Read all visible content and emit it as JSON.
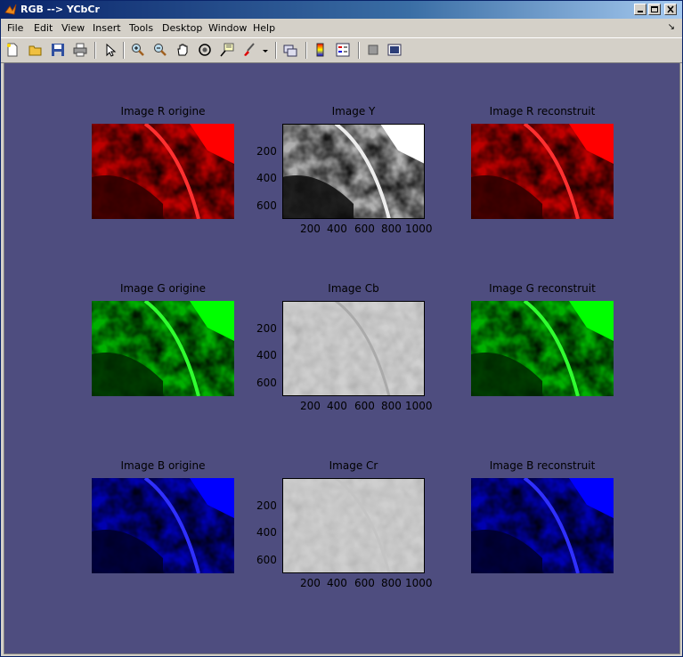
{
  "window": {
    "title": "RGB --> YCbCr"
  },
  "menu": [
    "File",
    "Edit",
    "View",
    "Insert",
    "Tools",
    "Desktop",
    "Window",
    "Help"
  ],
  "toolbar_icons": [
    "new-file-icon",
    "open-folder-icon",
    "save-icon",
    "print-icon",
    "pointer-icon",
    "zoom-in-icon",
    "zoom-out-icon",
    "pan-icon",
    "rotate-3d-icon",
    "data-cursor-icon",
    "brush-icon",
    "link-plot-icon",
    "colorbar-icon",
    "legend-icon",
    "hide-plot-tools-icon",
    "show-plot-tools-icon"
  ],
  "panels": {
    "r_orig": "Image R origine",
    "y": "Image Y",
    "r_rec": "Image R reconstruit",
    "g_orig": "Image G origine",
    "cb": "Image Cb",
    "g_rec": "Image G reconstruit",
    "b_orig": "Image B  origine",
    "cr": "Image Cr",
    "b_rec": "Image B  reconstruit"
  },
  "axis": {
    "yticks": [
      "200",
      "400",
      "600"
    ],
    "xticks": [
      "200",
      "400",
      "600",
      "800",
      "1000"
    ]
  },
  "colors": {
    "red": "#ff0000",
    "green": "#00ff00",
    "blue": "#0000ff",
    "background": "#4e4d7f"
  }
}
